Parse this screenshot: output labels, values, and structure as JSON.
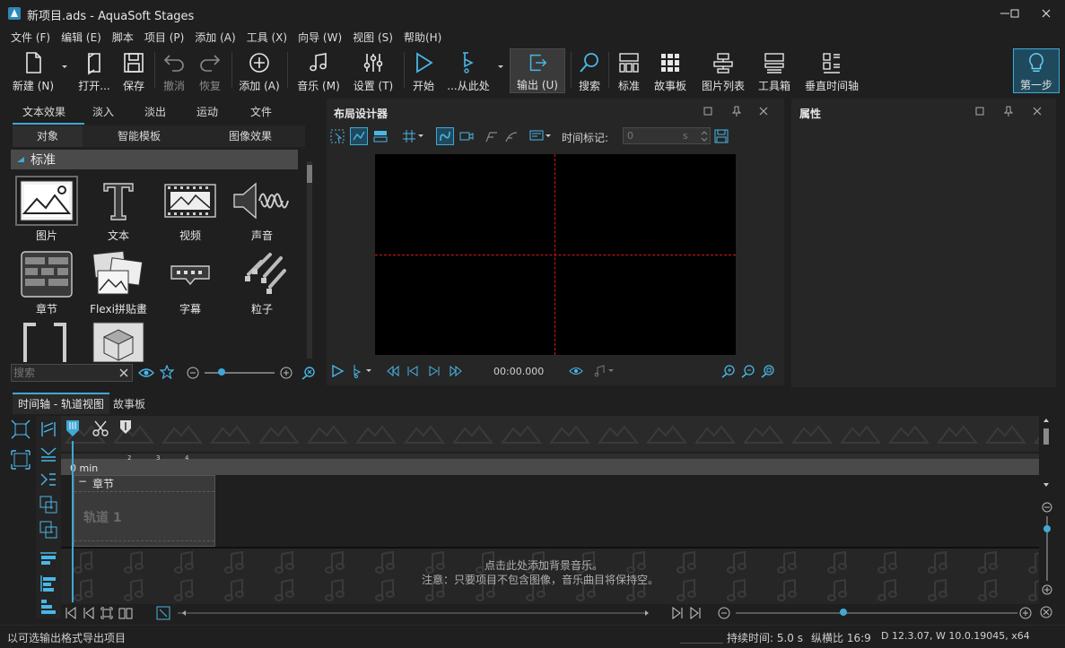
{
  "window": {
    "title": "新项目.ads - AquaSoft Stages"
  },
  "menu": [
    {
      "label": "文件 (F)"
    },
    {
      "label": "编辑 (E)"
    },
    {
      "label": "脚本"
    },
    {
      "label": "项目 (P)"
    },
    {
      "label": "添加 (A)"
    },
    {
      "label": "工具 (X)"
    },
    {
      "label": "向导 (W)"
    },
    {
      "label": "视图 (S)"
    },
    {
      "label": "帮助(H)"
    }
  ],
  "toolbar": {
    "new": "新建 (N)",
    "open": "打开...",
    "save": "保存",
    "undo": "撤消",
    "redo": "恢复",
    "add": "添加 (A)",
    "music": "音乐 (M)",
    "settings": "设置 (T)",
    "start": "开始",
    "from_here": "...从此处",
    "export": "输出 (U)",
    "search": "搜索",
    "standard": "标准",
    "storyboard": "故事板",
    "picture_list": "图片列表",
    "toolbox": "工具箱",
    "vertical_timeline": "垂直时间轴",
    "first_step": "第一步"
  },
  "library": {
    "tabs_row1": [
      "文本效果",
      "淡入",
      "淡出",
      "运动",
      "文件"
    ],
    "tabs_row2": [
      "对象",
      "智能模板",
      "图像效果"
    ],
    "active_tab_row2": "对象",
    "section": "标准",
    "items": [
      {
        "label": "图片",
        "icon": "picture-icon"
      },
      {
        "label": "文本",
        "icon": "text-icon"
      },
      {
        "label": "视频",
        "icon": "video-icon"
      },
      {
        "label": "声音",
        "icon": "sound-icon"
      },
      {
        "label": "章节",
        "icon": "chapter-icon"
      },
      {
        "label": "Flexi拼贴畫",
        "icon": "flexi-collage-icon"
      },
      {
        "label": "字幕",
        "icon": "caption-icon"
      },
      {
        "label": "粒子",
        "icon": "particle-icon"
      }
    ],
    "search_placeholder": "搜索"
  },
  "layout_designer": {
    "title": "布局设计器",
    "time_marker_label": "时间标记:",
    "time_marker_value": "0",
    "time_unit": "s",
    "playback_time": "00:00.000"
  },
  "properties": {
    "title": "属性"
  },
  "timeline": {
    "tabs": [
      "时间轴 - 轨道视图",
      "故事板"
    ],
    "ruler_label": "0 min",
    "ruler_ticks": [
      "2",
      "3",
      "4"
    ],
    "chapter_label": "章节",
    "track_label": "轨道 1",
    "music_hint_line1": "点击此处添加背景音乐。",
    "music_hint_line2": "注意：只要项目不包含图像，音乐曲目将保持空。"
  },
  "status": {
    "left": "以可选输出格式导出项目",
    "duration": "持续时间: 5.0 s",
    "aspect": "纵横比 16:9",
    "version": "D 12.3.07, W 10.0.19045, x64"
  },
  "colors": {
    "accent": "#3fa9d4",
    "background": "#1f1f1f",
    "panel": "#262626",
    "canvas": "#000000",
    "guide": "#d11a1a"
  }
}
